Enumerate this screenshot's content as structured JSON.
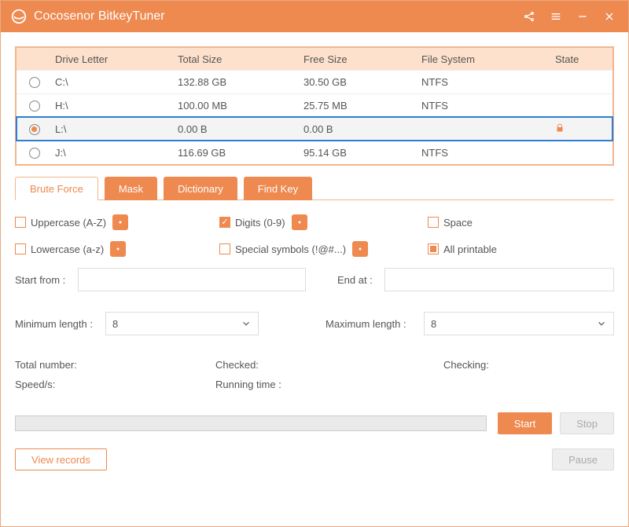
{
  "app": {
    "title": "Cocosenor BitkeyTuner"
  },
  "table": {
    "headers": {
      "drive": "Drive Letter",
      "total": "Total Size",
      "free": "Free Size",
      "fs": "File System",
      "state": "State"
    },
    "rows": [
      {
        "drive": "C:\\",
        "total": "132.88 GB",
        "free": "30.50 GB",
        "fs": "NTFS",
        "selected": false,
        "locked": false
      },
      {
        "drive": "H:\\",
        "total": "100.00 MB",
        "free": "25.75 MB",
        "fs": "NTFS",
        "selected": false,
        "locked": false
      },
      {
        "drive": "L:\\",
        "total": "0.00 B",
        "free": "0.00 B",
        "fs": "",
        "selected": true,
        "locked": true
      },
      {
        "drive": "J:\\",
        "total": "116.69 GB",
        "free": "95.14 GB",
        "fs": "NTFS",
        "selected": false,
        "locked": false
      }
    ]
  },
  "tabs": {
    "brute": "Brute Force",
    "mask": "Mask",
    "dict": "Dictionary",
    "findkey": "Find Key"
  },
  "opts": {
    "uppercase": "Uppercase (A-Z)",
    "lowercase": "Lowercase (a-z)",
    "digits": "Digits (0-9)",
    "special": "Special symbols (!@#...)",
    "space": "Space",
    "allprintable": "All printable"
  },
  "form": {
    "start_from_label": "Start from :",
    "end_at_label": "End at :",
    "min_len_label": "Minimum length :",
    "max_len_label": "Maximum length :",
    "min_len": "8",
    "max_len": "8"
  },
  "stats": {
    "total": "Total number:",
    "checked": "Checked:",
    "checking": "Checking:",
    "speed": "Speed/s:",
    "running": "Running time :"
  },
  "buttons": {
    "start": "Start",
    "stop": "Stop",
    "view_records": "View records",
    "pause": "Pause"
  }
}
